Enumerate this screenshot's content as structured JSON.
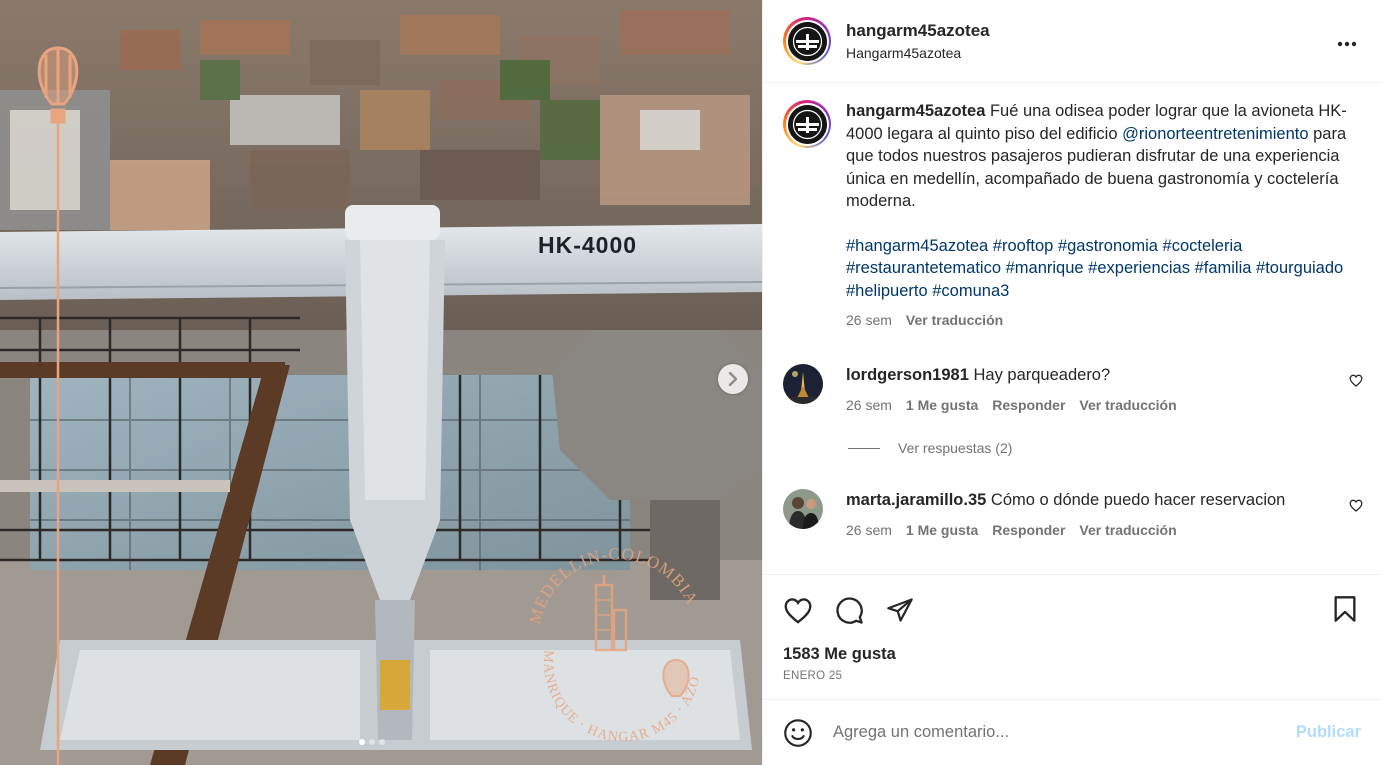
{
  "post": {
    "username": "hangarm45azotea",
    "subname": "Hangarm45azotea",
    "plane_registration": "HK-4000",
    "watermark": {
      "top": "MEDELLIN-COLOMBIA",
      "bottom": "MANRIQUE · HANGAR M45 · AZOTEA"
    }
  },
  "caption": {
    "username": "hangarm45azotea",
    "text_1": " Fué una odisea poder lograr que la avioneta HK-4000 legara al quinto piso del edificio ",
    "mention": "@rionorteentretenimiento",
    "text_2": " para que todos nuestros pasajeros pudieran disfrutar de una experiencia única en medellín, acompañado de buena gastronomía y coctelería moderna.",
    "hashtags": [
      "#hangarm45azotea",
      "#rooftop",
      "#gastronomia",
      "#cocteleria",
      "#restaurantetematico",
      "#manrique",
      "#experiencias",
      "#familia",
      "#tourguiado",
      "#helipuerto",
      "#comuna3"
    ],
    "time": "26 sem",
    "translate": "Ver traducción"
  },
  "comments": [
    {
      "username": "lordgerson1981",
      "text": "Hay parqueadero?",
      "time": "26 sem",
      "likes": "1 Me gusta",
      "reply": "Responder",
      "translate": "Ver traducción",
      "view_replies": "Ver respuestas (2)"
    },
    {
      "username": "marta.jaramillo.35",
      "text": "Cómo o dónde puedo hacer reservacion",
      "time": "26 sem",
      "likes": "1 Me gusta",
      "reply": "Responder",
      "translate": "Ver traducción"
    }
  ],
  "footer": {
    "likes": "1583 Me gusta",
    "date": "ENERO 25",
    "comment_placeholder": "Agrega un comentario...",
    "publish": "Publicar"
  },
  "carousel": {
    "slides": 3,
    "active": 0
  },
  "icons": [
    "more-icon",
    "heart-icon",
    "comment-icon",
    "share-icon",
    "bookmark-icon",
    "emoji-icon",
    "chevron-right-icon"
  ],
  "colors": {
    "link": "#00376b",
    "meta": "#737373",
    "publish": "#b3dbff",
    "watermark": "#e8a47e"
  }
}
